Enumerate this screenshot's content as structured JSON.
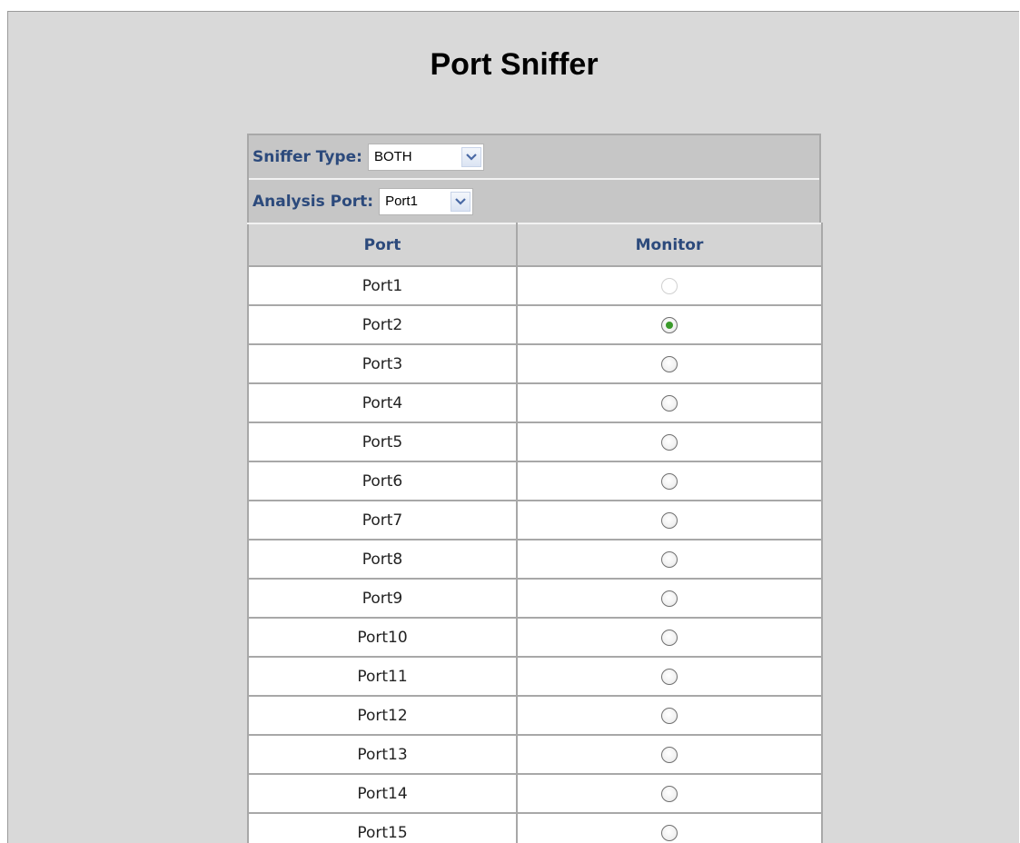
{
  "page": {
    "title": "Port Sniffer"
  },
  "controls": {
    "sniffer_type": {
      "label": "Sniffer Type:",
      "value": "BOTH"
    },
    "analysis_port": {
      "label": "Analysis Port:",
      "value": "Port1"
    }
  },
  "table": {
    "headers": [
      "Port",
      "Monitor"
    ],
    "rows": [
      {
        "port": "Port1",
        "monitor": "disabled"
      },
      {
        "port": "Port2",
        "monitor": "checked"
      },
      {
        "port": "Port3",
        "monitor": "unchecked"
      },
      {
        "port": "Port4",
        "monitor": "unchecked"
      },
      {
        "port": "Port5",
        "monitor": "unchecked"
      },
      {
        "port": "Port6",
        "monitor": "unchecked"
      },
      {
        "port": "Port7",
        "monitor": "unchecked"
      },
      {
        "port": "Port8",
        "monitor": "unchecked"
      },
      {
        "port": "Port9",
        "monitor": "unchecked"
      },
      {
        "port": "Port10",
        "monitor": "unchecked"
      },
      {
        "port": "Port11",
        "monitor": "unchecked"
      },
      {
        "port": "Port12",
        "monitor": "unchecked"
      },
      {
        "port": "Port13",
        "monitor": "unchecked"
      },
      {
        "port": "Port14",
        "monitor": "unchecked"
      },
      {
        "port": "Port15",
        "monitor": "unchecked"
      }
    ]
  },
  "icons": {
    "dropdown": "chevron-down-icon"
  },
  "colors": {
    "label_text": "#2c4a7c",
    "radio_checked": "#3a9a2a",
    "background": "#d9d9d9"
  }
}
